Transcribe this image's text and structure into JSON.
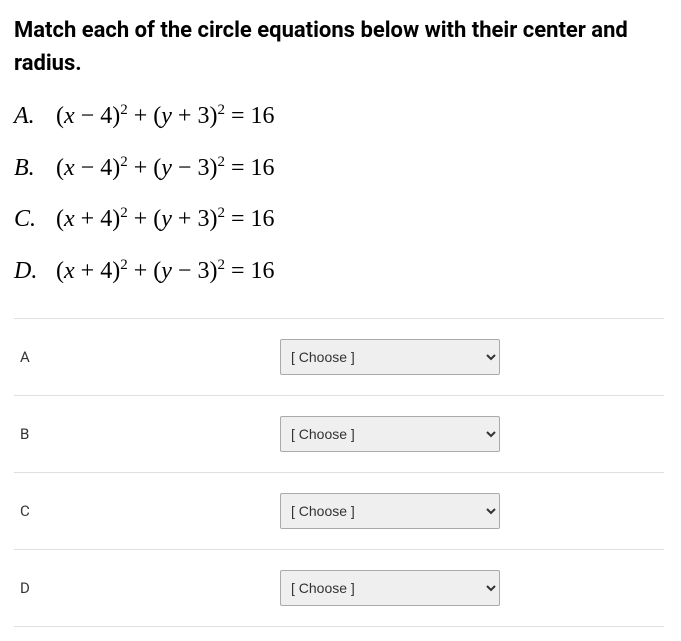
{
  "title": "Match each of the circle equations below with their center and radius.",
  "equations": {
    "A": {
      "label": "A.",
      "x_sign": "−",
      "x_val": "4",
      "y_sign": "+",
      "y_val": "3",
      "rhs": "16"
    },
    "B": {
      "label": "B.",
      "x_sign": "−",
      "x_val": "4",
      "y_sign": "−",
      "y_val": "3",
      "rhs": "16"
    },
    "C": {
      "label": "C.",
      "x_sign": "+",
      "x_val": "4",
      "y_sign": "+",
      "y_val": "3",
      "rhs": "16"
    },
    "D": {
      "label": "D.",
      "x_sign": "+",
      "x_val": "4",
      "y_sign": "−",
      "y_val": "3",
      "rhs": "16"
    }
  },
  "match_rows": {
    "A": {
      "label": "A",
      "placeholder": "[ Choose ]"
    },
    "B": {
      "label": "B",
      "placeholder": "[ Choose ]"
    },
    "C": {
      "label": "C",
      "placeholder": "[ Choose ]"
    },
    "D": {
      "label": "D",
      "placeholder": "[ Choose ]"
    }
  }
}
